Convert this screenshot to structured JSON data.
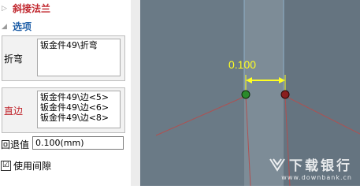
{
  "panel": {
    "section_title": "斜接法兰",
    "options_title": "选项",
    "bend": {
      "label": "折弯",
      "items": [
        "钣金件49\\折弯"
      ]
    },
    "edge": {
      "label": "直边",
      "items": [
        "钣金件49\\边<5>",
        "钣金件49\\边<6>",
        "钣金件49\\边<8>"
      ]
    },
    "offset": {
      "label": "回退值",
      "value": "0.100(mm)"
    },
    "use_gap": {
      "label": "使用间隙",
      "checked": true,
      "mark": "☑"
    }
  },
  "viewport": {
    "dimension_text": "0.100",
    "colors": {
      "background": "#6a7a86",
      "dimension": "#ffff20",
      "point_green": "#2a8a2a",
      "point_red": "#8a1e1e"
    }
  },
  "watermark": {
    "text": "下载银行",
    "url": "www.downbank.cn"
  }
}
